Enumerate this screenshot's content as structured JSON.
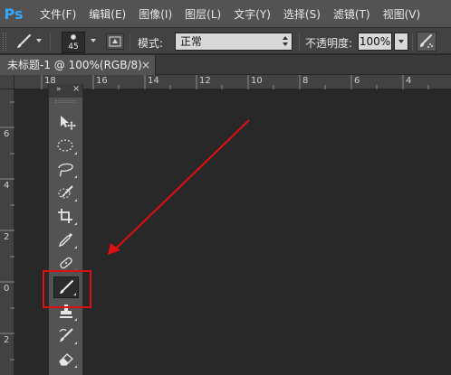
{
  "app": {
    "logo": "Ps",
    "menu": [
      "文件(F)",
      "编辑(E)",
      "图像(I)",
      "图层(L)",
      "文字(Y)",
      "选择(S)",
      "滤镜(T)",
      "视图(V)"
    ]
  },
  "options_bar": {
    "brush_size": "45",
    "mode_label": "模式:",
    "mode_value": "正常",
    "opacity_label": "不透明度:",
    "opacity_value": "100%"
  },
  "document_tab": {
    "title": "未标题-1 @ 100%(RGB/8)",
    "close": "×"
  },
  "rulers": {
    "horizontal": [
      "18",
      "16",
      "14",
      "12",
      "10",
      "8",
      "6",
      "4",
      "2"
    ],
    "vertical": [
      "6",
      "4",
      "2",
      "0",
      "2"
    ]
  },
  "toolbox": {
    "collapse_glyph": "»",
    "close_glyph": "×",
    "tools": [
      {
        "name": "move-tool",
        "icon": "move-icon"
      },
      {
        "name": "marquee-tool",
        "icon": "ellipse-marquee-icon"
      },
      {
        "name": "lasso-tool",
        "icon": "lasso-icon"
      },
      {
        "name": "quick-selection-tool",
        "icon": "quick-selection-icon"
      },
      {
        "name": "crop-tool",
        "icon": "crop-icon"
      },
      {
        "name": "eyedropper-tool",
        "icon": "eyedropper-icon"
      },
      {
        "name": "healing-brush-tool",
        "icon": "bandage-icon"
      },
      {
        "name": "brush-tool",
        "icon": "brush-icon",
        "active": true
      },
      {
        "name": "clone-stamp-tool",
        "icon": "stamp-icon"
      },
      {
        "name": "history-brush-tool",
        "icon": "history-brush-icon"
      },
      {
        "name": "eraser-tool",
        "icon": "eraser-icon"
      }
    ]
  },
  "annotation": {
    "color": "#e01010",
    "target": "brush-tool"
  }
}
